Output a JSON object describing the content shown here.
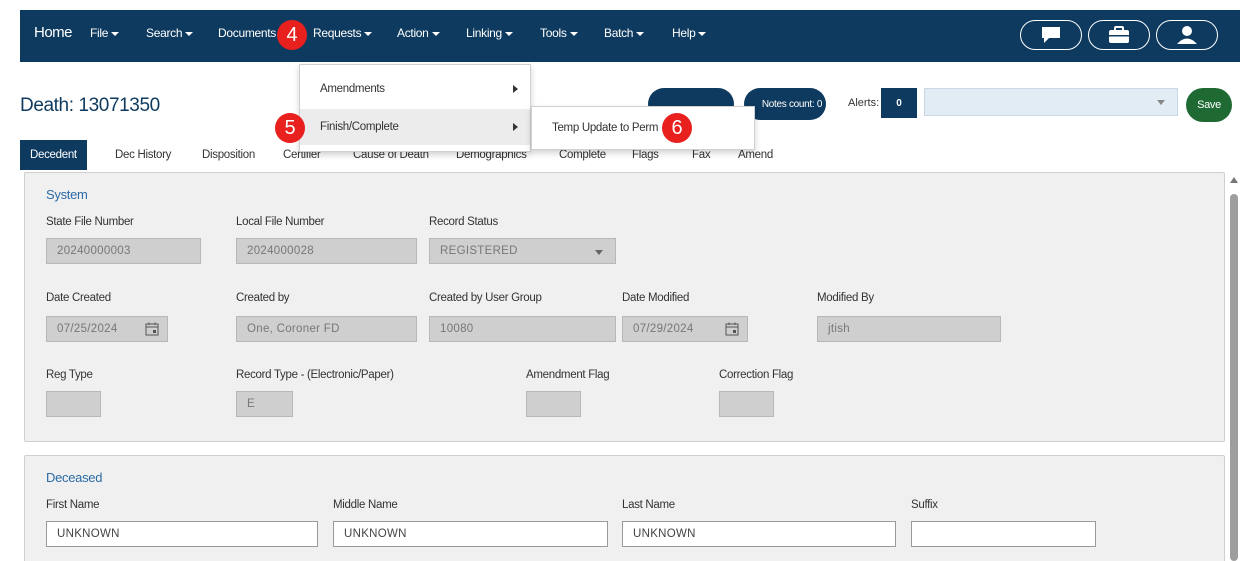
{
  "nav": {
    "home": "Home",
    "items": [
      "File",
      "Search",
      "Documents",
      "Requests",
      "Action",
      "Linking",
      "Tools",
      "Batch",
      "Help"
    ],
    "icons": [
      "chat-icon",
      "briefcase-icon",
      "user-icon"
    ]
  },
  "page": {
    "title": "Death: 13071350",
    "notes_count": "Notes count: 0",
    "alerts_label": "Alerts:",
    "alerts_count": "0",
    "save_label": "Save"
  },
  "tabs": [
    "Decedent",
    "Dec History",
    "Disposition",
    "Certifier",
    "Cause of Death",
    "Demographics",
    "Complete",
    "Flags",
    "Fax",
    "Amend"
  ],
  "dropdown": {
    "items": [
      {
        "label": "Amendments"
      },
      {
        "label": "Finish/Complete"
      }
    ],
    "submenu": {
      "label": "Temp Update to Perm"
    }
  },
  "steps": [
    "4",
    "5",
    "6"
  ],
  "system": {
    "title": "System",
    "state_file_number": {
      "label": "State File Number",
      "value": "20240000003"
    },
    "local_file_number": {
      "label": "Local File Number",
      "value": "2024000028"
    },
    "record_status": {
      "label": "Record Status",
      "value": "REGISTERED"
    },
    "date_created": {
      "label": "Date Created",
      "value": "07/25/2024"
    },
    "created_by": {
      "label": "Created by",
      "value": "One, Coroner FD"
    },
    "created_by_group": {
      "label": "Created by User Group",
      "value": "10080"
    },
    "date_modified": {
      "label": "Date Modified",
      "value": "07/29/2024"
    },
    "modified_by": {
      "label": "Modified By",
      "value": "jtish"
    },
    "reg_type": {
      "label": "Reg Type",
      "value": ""
    },
    "record_type": {
      "label": "Record Type - (Electronic/Paper)",
      "value": "E"
    },
    "amendment_flag": {
      "label": "Amendment Flag",
      "value": ""
    },
    "correction_flag": {
      "label": "Correction Flag",
      "value": ""
    }
  },
  "deceased": {
    "title": "Deceased",
    "first_name": {
      "label": "First Name",
      "value": "UNKNOWN"
    },
    "middle_name": {
      "label": "Middle Name",
      "value": "UNKNOWN"
    },
    "last_name": {
      "label": "Last Name",
      "value": "UNKNOWN"
    },
    "suffix": {
      "label": "Suffix",
      "value": ""
    }
  },
  "colors": {
    "navy": "#0e3a5f",
    "save_green": "#1f6a33",
    "step_red": "#e8211f",
    "section_title_blue": "#2b6aa6"
  }
}
